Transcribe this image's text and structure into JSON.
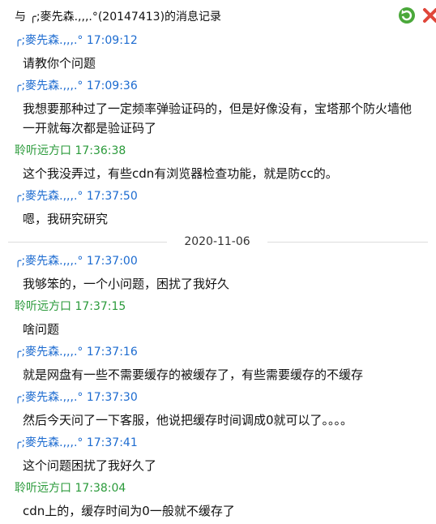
{
  "window": {
    "title": "与 ╭;麥先森.,,,.°(20147413)的消息记录"
  },
  "colors": {
    "remote_sender": "#1c6bd0",
    "self_sender": "#2a9a3a",
    "refresh_icon": "#4aa83a",
    "close_icon": "#e0463a"
  },
  "messages_before": [
    {
      "sender": "╭;麥先森.,,,.°",
      "time": "17:09:12",
      "text": "请教你个问题",
      "side": "remote"
    },
    {
      "sender": "╭;麥先森.,,,.°",
      "time": "17:09:36",
      "text": "我想要那种过了一定频率弹验证码的，但是好像没有，宝塔那个防火墙他一开就每次都是验证码了",
      "side": "remote"
    },
    {
      "sender": "聆听远方口",
      "time": "17:36:38",
      "text": "这个我没弄过，有些cdn有浏览器检查功能，就是防cc的。",
      "side": "self"
    },
    {
      "sender": "╭;麥先森.,,,.°",
      "time": "17:37:50",
      "text": "嗯，我研究研究",
      "side": "remote"
    }
  ],
  "date_separator": "2020-11-06",
  "messages_after": [
    {
      "sender": "╭;麥先森.,,,.°",
      "time": "17:37:00",
      "text": "我够笨的，一个小问题，困扰了我好久",
      "side": "remote"
    },
    {
      "sender": "聆听远方口",
      "time": "17:37:15",
      "text": "啥问题",
      "side": "self"
    },
    {
      "sender": "╭;麥先森.,,,.°",
      "time": "17:37:16",
      "text": "就是网盘有一些不需要缓存的被缓存了，有些需要缓存的不缓存",
      "side": "remote"
    },
    {
      "sender": "╭;麥先森.,,,.°",
      "time": "17:37:30",
      "text": "然后今天问了一下客服，他说把缓存时间调成0就可以了。。。。",
      "side": "remote"
    },
    {
      "sender": "╭;麥先森.,,,.°",
      "time": "17:37:41",
      "text": "这个问题困扰了我好久了",
      "side": "remote"
    },
    {
      "sender": "聆听远方口",
      "time": "17:38:04",
      "text": "cdn上的，缓存时间为0一般就不缓存了",
      "side": "self"
    }
  ]
}
